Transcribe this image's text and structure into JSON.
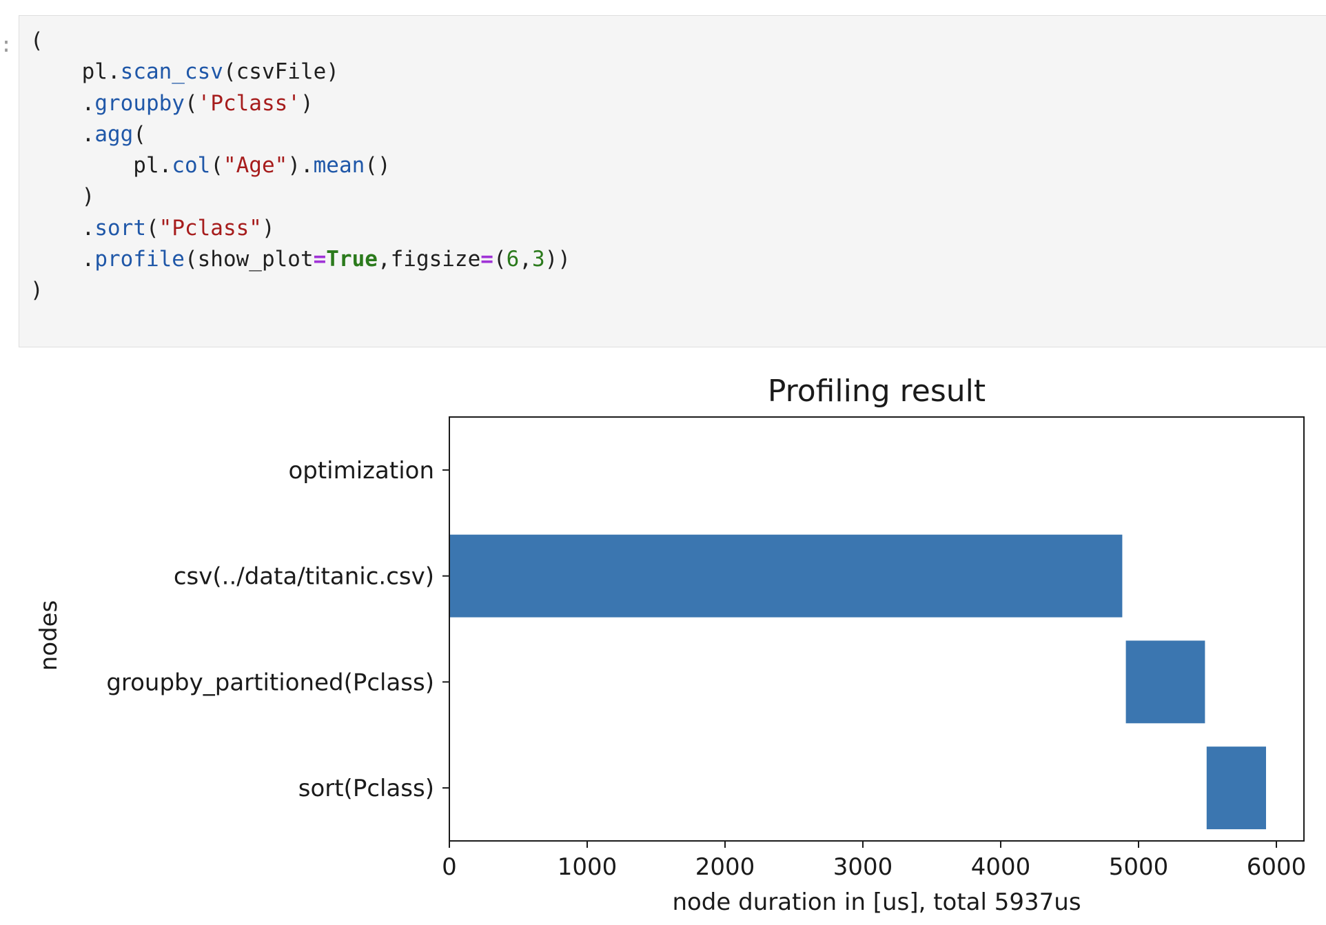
{
  "prompt_marker": ":",
  "code_cell": {
    "lines": [
      [
        {
          "t": "plain",
          "v": "("
        }
      ],
      [
        {
          "t": "plain",
          "v": "    pl."
        },
        {
          "t": "fn",
          "v": "scan_csv"
        },
        {
          "t": "plain",
          "v": "(csvFile)"
        }
      ],
      [
        {
          "t": "plain",
          "v": "    ."
        },
        {
          "t": "fn",
          "v": "groupby"
        },
        {
          "t": "plain",
          "v": "("
        },
        {
          "t": "str",
          "v": "'Pclass'"
        },
        {
          "t": "plain",
          "v": ")"
        }
      ],
      [
        {
          "t": "plain",
          "v": "    ."
        },
        {
          "t": "fn",
          "v": "agg"
        },
        {
          "t": "plain",
          "v": "("
        }
      ],
      [
        {
          "t": "plain",
          "v": "        pl."
        },
        {
          "t": "fn",
          "v": "col"
        },
        {
          "t": "plain",
          "v": "("
        },
        {
          "t": "str",
          "v": "\"Age\""
        },
        {
          "t": "plain",
          "v": ")."
        },
        {
          "t": "fn",
          "v": "mean"
        },
        {
          "t": "plain",
          "v": "()"
        }
      ],
      [
        {
          "t": "plain",
          "v": "    )"
        }
      ],
      [
        {
          "t": "plain",
          "v": "    ."
        },
        {
          "t": "fn",
          "v": "sort"
        },
        {
          "t": "plain",
          "v": "("
        },
        {
          "t": "str",
          "v": "\"Pclass\""
        },
        {
          "t": "plain",
          "v": ")"
        }
      ],
      [
        {
          "t": "plain",
          "v": "    ."
        },
        {
          "t": "fn",
          "v": "profile"
        },
        {
          "t": "plain",
          "v": "(show_plot"
        },
        {
          "t": "op",
          "v": "="
        },
        {
          "t": "kw",
          "v": "True"
        },
        {
          "t": "plain",
          "v": ",figsize"
        },
        {
          "t": "op",
          "v": "="
        },
        {
          "t": "plain",
          "v": "("
        },
        {
          "t": "num",
          "v": "6"
        },
        {
          "t": "plain",
          "v": ","
        },
        {
          "t": "num",
          "v": "3"
        },
        {
          "t": "plain",
          "v": "))"
        }
      ],
      [
        {
          "t": "plain",
          "v": ")"
        }
      ]
    ]
  },
  "colors": {
    "bar": "#3b76b0",
    "function": "#1f57a8",
    "string": "#a61c1c",
    "operator": "#a033d6",
    "keyword": "#2b7a1c"
  },
  "chart_data": {
    "type": "bar",
    "orientation": "horizontal",
    "title": "Profiling result",
    "xlabel": "node duration in [us], total 5937us",
    "ylabel": "nodes",
    "xlim": [
      0,
      6200
    ],
    "xticks": [
      0,
      1000,
      2000,
      3000,
      4000,
      5000,
      6000
    ],
    "xtick_labels": [
      "0",
      "1000",
      "2000",
      "3000",
      "4000",
      "5000",
      "6000"
    ],
    "grid": false,
    "categories": [
      "optimization",
      "csv(../data/titanic.csv)",
      "groupby_partitioned(Pclass)",
      "sort(Pclass)"
    ],
    "bars": [
      {
        "label": "optimization",
        "start": 0,
        "end": 0
      },
      {
        "label": "csv(../data/titanic.csv)",
        "start": 0,
        "end": 4882
      },
      {
        "label": "groupby_partitioned(Pclass)",
        "start": 4908,
        "end": 5482
      },
      {
        "label": "sort(Pclass)",
        "start": 5494,
        "end": 5925
      }
    ]
  }
}
